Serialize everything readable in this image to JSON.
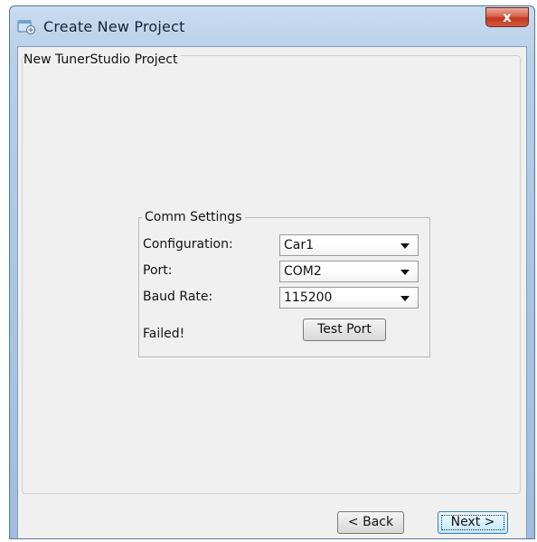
{
  "window": {
    "title": "Create New Project",
    "close_label": "x"
  },
  "project_group": {
    "legend": "New TunerStudio Project"
  },
  "comm_settings": {
    "legend": "Comm Settings",
    "configuration": {
      "label": "Configuration:",
      "value": "Car1"
    },
    "port": {
      "label": "Port:",
      "value": "COM2"
    },
    "baud_rate": {
      "label": "Baud Rate:",
      "value": "115200"
    },
    "status_text": "Failed!",
    "test_port_label": "Test Port"
  },
  "footer": {
    "back_label": "< Back",
    "next_label": "Next >"
  },
  "icons": {
    "title_icon": "app-window-icon",
    "dropdown_arrow": "chevron-down-icon"
  }
}
